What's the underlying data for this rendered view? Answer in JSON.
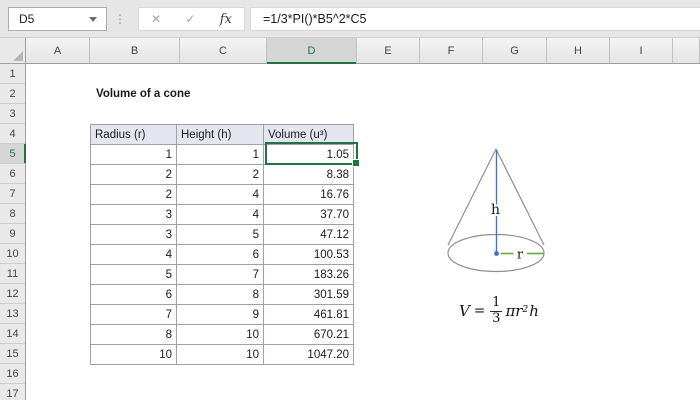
{
  "formula_bar": {
    "cell_reference": "D5",
    "formula": "=1/3*PI()*B5^2*C5",
    "cancel_icon": "✕",
    "enter_icon": "✓",
    "fx_icon": "fx",
    "splitter_dots": "⋮"
  },
  "sheet": {
    "column_headers": [
      "A",
      "B",
      "C",
      "D",
      "E",
      "F",
      "G",
      "H",
      "I"
    ],
    "row_headers": [
      "1",
      "2",
      "3",
      "4",
      "5",
      "6",
      "7",
      "8",
      "9",
      "10",
      "11",
      "12",
      "13",
      "14",
      "15",
      "16",
      "17"
    ],
    "selected_cell": "D5",
    "selected_column": "D",
    "selected_row": "5"
  },
  "content": {
    "title": "Volume of a cone",
    "table": {
      "headers": [
        "Radius (r)",
        "Height (h)",
        "Volume (u³)"
      ],
      "rows": [
        [
          "1",
          "1",
          "1.05"
        ],
        [
          "2",
          "2",
          "8.38"
        ],
        [
          "2",
          "4",
          "16.76"
        ],
        [
          "3",
          "4",
          "37.70"
        ],
        [
          "3",
          "5",
          "47.12"
        ],
        [
          "4",
          "6",
          "100.53"
        ],
        [
          "5",
          "7",
          "183.26"
        ],
        [
          "6",
          "8",
          "301.59"
        ],
        [
          "7",
          "9",
          "461.81"
        ],
        [
          "8",
          "10",
          "670.21"
        ],
        [
          "10",
          "10",
          "1047.20"
        ]
      ]
    },
    "diagram": {
      "height_label": "h",
      "radius_label": "r"
    },
    "equation": {
      "lhs": "V",
      "equals": "=",
      "numerator": "1",
      "denominator": "3",
      "pi_r": "πr",
      "exponent": "2",
      "h": "h"
    }
  },
  "colors": {
    "accent_green": "#217346",
    "line_blue": "#4472C4",
    "line_green": "#70AD47",
    "cone_outline": "#8f8f8f",
    "table_border": "#9f9fae",
    "table_header_fill": "#e5e5f0",
    "topbar_bg": "#e6e6e6",
    "header_bg": "#e9e9e9",
    "header_selected_bg": "#d5d5d5"
  }
}
